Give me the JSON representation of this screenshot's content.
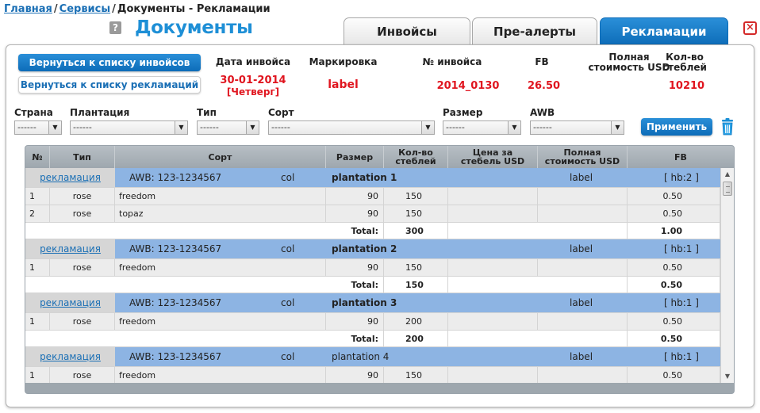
{
  "breadcrumb": {
    "home": "Главная",
    "services": "Сервисы",
    "current": "Документы - Рекламации"
  },
  "logo": "Документы",
  "help_glyph": "?",
  "tabs": [
    {
      "label": "Инвойсы",
      "active": false
    },
    {
      "label": "Пре-алерты",
      "active": false
    },
    {
      "label": "Рекламации",
      "active": true
    }
  ],
  "buttons": {
    "back_to_invoices": "Вернуться к списку инвойсов",
    "back_to_claims": "Вернуться к списку рекламаций",
    "apply": "Применить"
  },
  "invoice_header": {
    "date_label": "Дата инвойса",
    "date_value": "30-01-2014",
    "weekday_value": "[Четверг]",
    "marking_label": "Маркировка",
    "marking_value": "label",
    "number_label": "№ инвойса",
    "number_value": "2014_0130",
    "fb_label": "FB",
    "fb_value": "26.50",
    "total_cost_label_1": "Полная",
    "total_cost_label_2": "стоимость USD",
    "total_cost_value": "",
    "stems_label_1": "Кол-во",
    "stems_label_2": "стеблей",
    "stems_value": "10210"
  },
  "filters": [
    {
      "label": "Страна",
      "value": "------"
    },
    {
      "label": "Плантация",
      "value": "------"
    },
    {
      "label": "Тип",
      "value": "------"
    },
    {
      "label": "Сорт",
      "value": "------"
    },
    {
      "label": "Размер",
      "value": "------"
    },
    {
      "label": "AWB",
      "value": "------"
    }
  ],
  "grid": {
    "columns": [
      {
        "l1": "№",
        "l2": ""
      },
      {
        "l1": "Тип",
        "l2": ""
      },
      {
        "l1": "Сорт",
        "l2": ""
      },
      {
        "l1": "Размер",
        "l2": ""
      },
      {
        "l1": "Кол-во",
        "l2": "стеблей"
      },
      {
        "l1": "Цена за",
        "l2": "стебель USD"
      },
      {
        "l1": "Полная",
        "l2": "стоимость USD"
      },
      {
        "l1": "FB",
        "l2": ""
      }
    ],
    "total_label": "Total:",
    "groups": [
      {
        "link": "рекламация",
        "awb": "AWB: 123-1234567",
        "col": "col",
        "plantation": "plantation 1",
        "plantation_bold": true,
        "label": "label",
        "hb": "[ hb:2 ]",
        "items": [
          {
            "n": "1",
            "type": "rose",
            "sort": "freedom",
            "size": "90",
            "stems": "150",
            "fb": "0.50"
          },
          {
            "n": "2",
            "type": "rose",
            "sort": "topaz",
            "size": "90",
            "stems": "150",
            "fb": "0.50"
          }
        ],
        "total_stems": "300",
        "total_fb": "1.00"
      },
      {
        "link": "рекламация",
        "awb": "AWB: 123-1234567",
        "col": "col",
        "plantation": "plantation 2",
        "plantation_bold": true,
        "label": "label",
        "hb": "[ hb:1 ]",
        "items": [
          {
            "n": "1",
            "type": "rose",
            "sort": "freedom",
            "size": "90",
            "stems": "150",
            "fb": "0.50"
          }
        ],
        "total_stems": "150",
        "total_fb": "0.50"
      },
      {
        "link": "рекламация",
        "awb": "AWB: 123-1234567",
        "col": "col",
        "plantation": "plantation 3",
        "plantation_bold": true,
        "label": "label",
        "hb": "[ hb:1 ]",
        "items": [
          {
            "n": "1",
            "type": "rose",
            "sort": "freedom",
            "size": "90",
            "stems": "200",
            "fb": "0.50"
          }
        ],
        "total_stems": "200",
        "total_fb": "0.50"
      },
      {
        "link": "рекламация",
        "awb": "AWB: 123-1234567",
        "col": "col",
        "plantation": "plantation 4",
        "plantation_bold": false,
        "label": "label",
        "hb": "[ hb:1 ]",
        "items": [
          {
            "n": "1",
            "type": "rose",
            "sort": "freedom",
            "size": "90",
            "stems": "150",
            "fb": "0.50"
          }
        ]
      }
    ]
  },
  "colors": {
    "accent": "#1a7cc7",
    "red_value": "#e0151f",
    "group_row": "#8db4e3"
  }
}
